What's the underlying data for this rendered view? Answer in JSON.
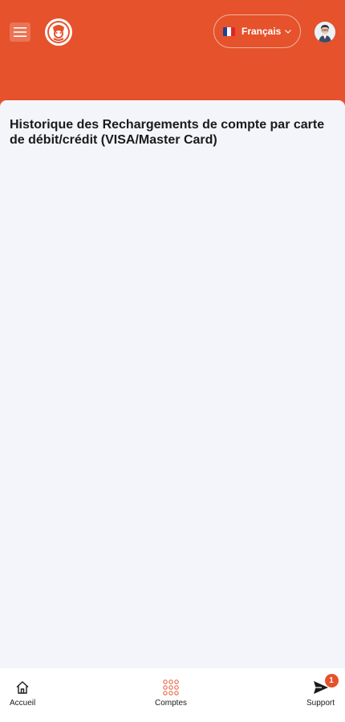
{
  "header": {
    "language": {
      "flag": "france-flag-icon",
      "label": "Français"
    }
  },
  "page": {
    "title": "Historique des Rechargements de compte par carte de débit/crédit (VISA/Master Card)"
  },
  "bottom_nav": {
    "items": [
      {
        "icon": "home-icon",
        "label": "Accueil"
      },
      {
        "icon": "grid-icon",
        "label": "Comptes"
      },
      {
        "icon": "send-icon",
        "label": "Support",
        "badge": "1"
      }
    ]
  },
  "colors": {
    "brand": "#e5522b",
    "content_bg": "#f4f5fb"
  }
}
